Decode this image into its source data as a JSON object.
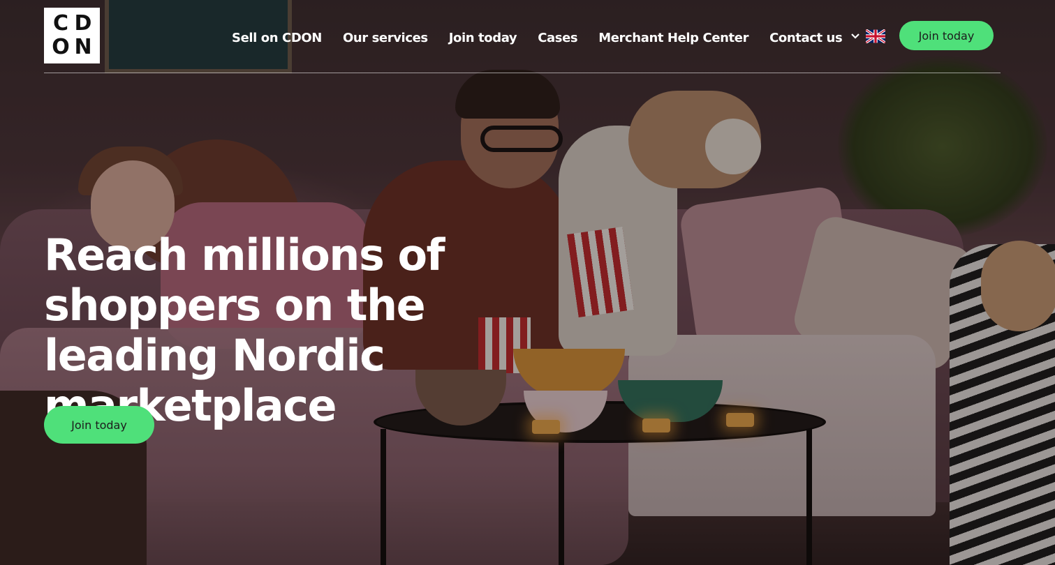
{
  "logo": {
    "letters": [
      "C",
      "D",
      "O",
      "N"
    ]
  },
  "nav": {
    "items": [
      {
        "label": "Sell on CDON"
      },
      {
        "label": "Our services"
      },
      {
        "label": "Join today"
      },
      {
        "label": "Cases"
      },
      {
        "label": "Merchant Help Center"
      },
      {
        "label": "Contact us"
      }
    ]
  },
  "language": {
    "chevron_icon": "chevron-down-icon",
    "flag_icon": "uk-flag-icon"
  },
  "header": {
    "cta_label": "Join today"
  },
  "hero": {
    "headline": "Reach millions of shoppers on the leading Nordic marketplace",
    "cta_label": "Join today"
  },
  "colors": {
    "accent": "#4fe07a",
    "text_on_hero": "#ffffff",
    "button_text": "#1c1c1c"
  }
}
